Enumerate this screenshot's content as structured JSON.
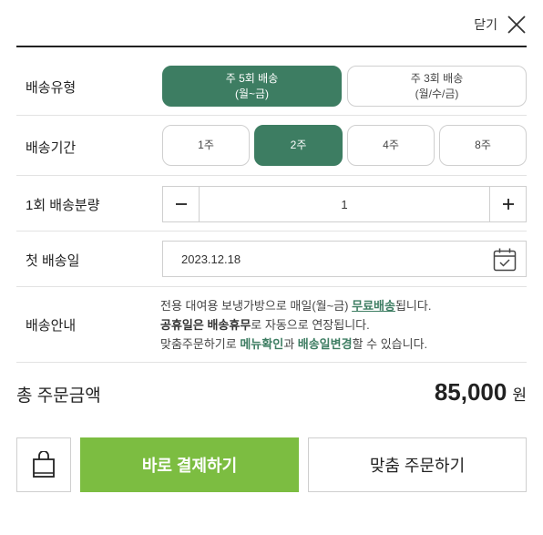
{
  "header": {
    "close_label": "닫기"
  },
  "delivery_type": {
    "label": "배송유형",
    "options": [
      {
        "line1": "주 5회 배송",
        "line2": "(월~금)",
        "selected": true
      },
      {
        "line1": "주 3회 배송",
        "line2": "(월/수/금)",
        "selected": false
      }
    ]
  },
  "delivery_period": {
    "label": "배송기간",
    "options": [
      {
        "label": "1주",
        "selected": false
      },
      {
        "label": "2주",
        "selected": true
      },
      {
        "label": "4주",
        "selected": false
      },
      {
        "label": "8주",
        "selected": false
      }
    ]
  },
  "quantity": {
    "label": "1회 배송분량",
    "value": "1"
  },
  "first_delivery": {
    "label": "첫 배송일",
    "date": "2023.12.18"
  },
  "delivery_info": {
    "label": "배송안내",
    "line1_a": "전용 대여용 보냉가방으로 매일(월~금) ",
    "line1_b": "무료배송",
    "line1_c": "됩니다.",
    "line2_a": "공휴일은 ",
    "line2_b": "배송휴무",
    "line2_c": "로 자동으로 연장됩니다.",
    "line3_a": "맞춤주문하기로 ",
    "line3_b": "메뉴확인",
    "line3_c": "과 ",
    "line3_d": "배송일변경",
    "line3_e": "할 수 있습니다."
  },
  "total": {
    "label": "총 주문금액",
    "amount": "85,000",
    "unit": "원"
  },
  "actions": {
    "pay_label": "바로 결제하기",
    "custom_order_label": "맞춤 주문하기"
  },
  "colors": {
    "accent": "#3d7d62",
    "pay": "#7cbd41"
  },
  "icons": {
    "close": "close-icon",
    "minus": "minus-icon",
    "plus": "plus-icon",
    "calendar": "calendar-icon",
    "bag": "bag-icon"
  }
}
